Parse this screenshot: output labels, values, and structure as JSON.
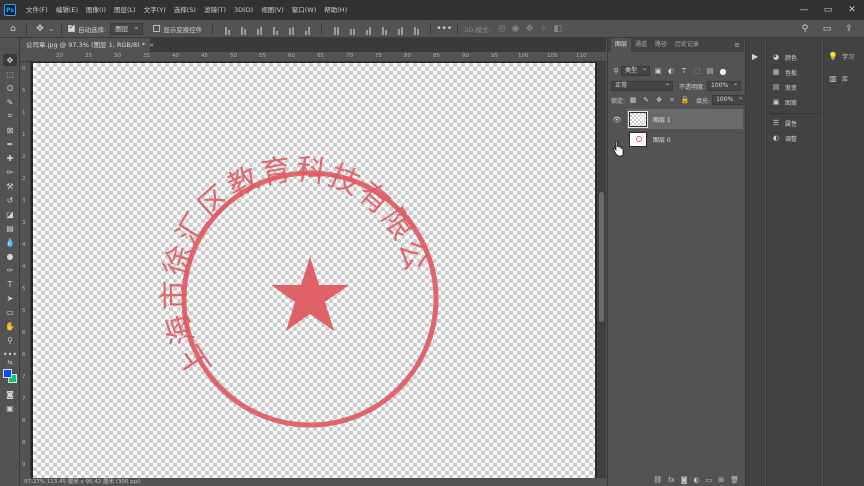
{
  "app": {
    "logo": "Ps"
  },
  "menu": [
    "文件(F)",
    "编辑(E)",
    "图像(I)",
    "图层(L)",
    "文字(Y)",
    "选择(S)",
    "滤镜(T)",
    "3D(D)",
    "视图(V)",
    "窗口(W)",
    "帮助(H)"
  ],
  "options": {
    "auto_select_label": "自动选择:",
    "auto_select_target": "图层",
    "show_transform_label": "显示变换控件",
    "mode_3d_label": "3D 模式:"
  },
  "document": {
    "tab_title": "公司章.jpg @ 97.3% (图层 1, RGB/8) *",
    "tab_close": "×"
  },
  "ruler": {
    "top_ticks": [
      "20",
      "25",
      "30",
      "35",
      "40",
      "45",
      "50",
      "55",
      "60",
      "65",
      "70",
      "75",
      "80",
      "85",
      "90",
      "95",
      "100",
      "105",
      "110"
    ],
    "left_ticks": [
      "0",
      "5",
      "1",
      "1",
      "2",
      "2",
      "3",
      "3",
      "4",
      "4",
      "5",
      "5",
      "6",
      "6",
      "7",
      "7",
      "8",
      "8",
      "9"
    ]
  },
  "stamp": {
    "arc_text": "上海市徐汇区教育科技有限公司",
    "color": "#e05a62"
  },
  "status": {
    "text": "97.27%   113.45 厘米 x 95.42 厘米 (300 ppi)"
  },
  "layers_panel": {
    "tabs": [
      "图层",
      "通道",
      "路径",
      "历史记录"
    ],
    "filter_kind": "类型",
    "blend_mode": "正常",
    "opacity_label": "不透明度:",
    "opacity_value": "100%",
    "lock_label": "锁定:",
    "fill_label": "填充:",
    "fill_value": "100%",
    "layers": [
      {
        "name": "图层 1",
        "selected": true,
        "visible": true
      },
      {
        "name": "图层 0",
        "selected": false,
        "visible": false
      }
    ],
    "bottom_icons": [
      "link-icon",
      "fx-icon",
      "mask-icon",
      "adjustment-icon",
      "group-icon",
      "new-layer-icon",
      "delete-icon"
    ]
  },
  "right_panels": {
    "group1": [
      {
        "icon": "color-icon",
        "label": "颜色"
      },
      {
        "icon": "swatches-icon",
        "label": "色板"
      },
      {
        "icon": "gradient-icon",
        "label": "渐变"
      },
      {
        "icon": "pattern-icon",
        "label": "图案"
      }
    ],
    "group2": [
      {
        "icon": "properties-icon",
        "label": "属性"
      },
      {
        "icon": "adjustments-icon",
        "label": "调整"
      }
    ],
    "group3": [
      {
        "icon": "learn-icon",
        "label": "学习"
      },
      {
        "icon": "library-icon",
        "label": "库"
      }
    ]
  },
  "colors": {
    "foreground": "#0050ff",
    "background": "#12c47a",
    "accent": "#31a8ff"
  }
}
